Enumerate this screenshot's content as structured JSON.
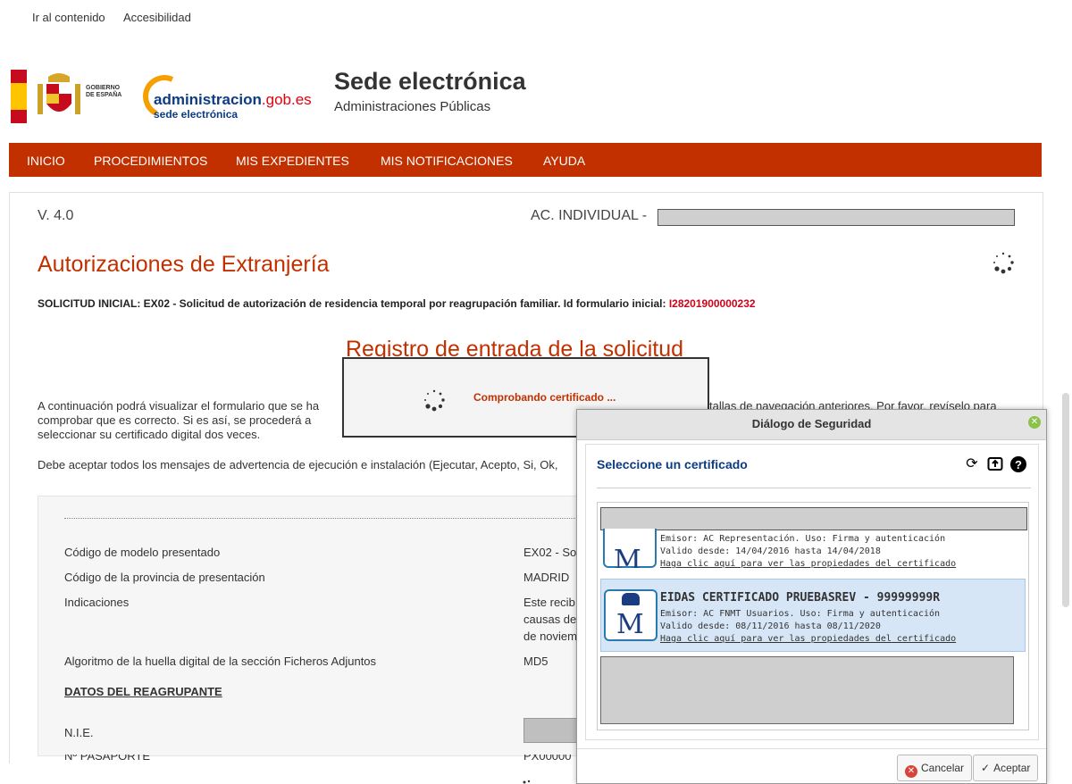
{
  "skip_links": {
    "content": "Ir al contenido",
    "accessibility": "Accesibilidad"
  },
  "logo": {
    "gobierno": "GOBIERNO",
    "espana": "DE ESPAÑA",
    "admin": "administracion",
    "gob": ".gob.es",
    "sede": "sede electrónica"
  },
  "header": {
    "title": "Sede electrónica",
    "subtitle": "Administraciones Públicas"
  },
  "nav": [
    "INICIO",
    "PROCEDIMIENTOS",
    "MIS EXPEDIENTES",
    "MIS NOTIFICACIONES",
    "AYUDA"
  ],
  "main": {
    "version": "V. 4.0",
    "ac_label": "AC. INDIVIDUAL -",
    "heading": "Autorizaciones de Extranjería",
    "solicitud": "SOLICITUD INICIAL: EX02 - Solicitud de autorización de residencia temporal por reagrupación familiar. Id formulario inicial: ",
    "solicitud_id": "I28201900000232",
    "registro": "Registro de entrada de la solicitud",
    "para1_line1_left": "A continuación podrá visualizar el formulario que se ha",
    "para1_line1_right": "tallas de navegación anteriores. Por favor, revíselo para",
    "para1_line2": "comprobar que es correcto. Si es así, se procederá a",
    "para1_line3": "seleccionar su certificado digital dos veces.",
    "para2": "Debe aceptar todos los mensajes de advertencia de ejecución e instalación (Ejecutar, Acepto, Si, Ok,",
    "rows": [
      {
        "label": "Código de modelo presentado",
        "value": "EX02 - So"
      },
      {
        "label": "Código de la provincia de presentación",
        "value": "MADRID"
      },
      {
        "label": "Indicaciones",
        "value": "Este recib"
      },
      {
        "label": "Algoritmo de la huella digital de la sección Ficheros Adjuntos",
        "value": "MD5"
      }
    ],
    "indicaciones_extra": [
      "causas de",
      "de noviem"
    ],
    "datos": "DATOS DEL REAGRUPANTE",
    "nie": "N.I.E.",
    "pasaporte": "Nº PASAPORTE",
    "pasaporte_value": "PX00000"
  },
  "loading": {
    "text": "Comprobando certificado ..."
  },
  "dialog": {
    "title": "Diálogo de Seguridad",
    "heading": "Seleccione un certificado",
    "certs": [
      {
        "issuer": "Emisor: AC Representación. Uso: Firma y autenticación",
        "valid": "Valido desde: 14/04/2016 hasta 14/04/2018",
        "link": "Haga clic aquí para ver las propiedades del certificado"
      },
      {
        "name": "EIDAS CERTIFICADO PRUEBASREV - 99999999R",
        "issuer": "Emisor: AC FNMT Usuarios. Uso: Firma y autenticación",
        "valid": "Valido desde: 08/11/2016 hasta 08/11/2020",
        "link": "Haga clic aquí para ver las propiedades del certificado"
      }
    ],
    "cancel": "Cancelar",
    "accept": "Aceptar"
  },
  "colors": {
    "brand_red": "#c23000",
    "link_blue": "#0d3c84",
    "selected_cert": "#d6e6f7"
  }
}
